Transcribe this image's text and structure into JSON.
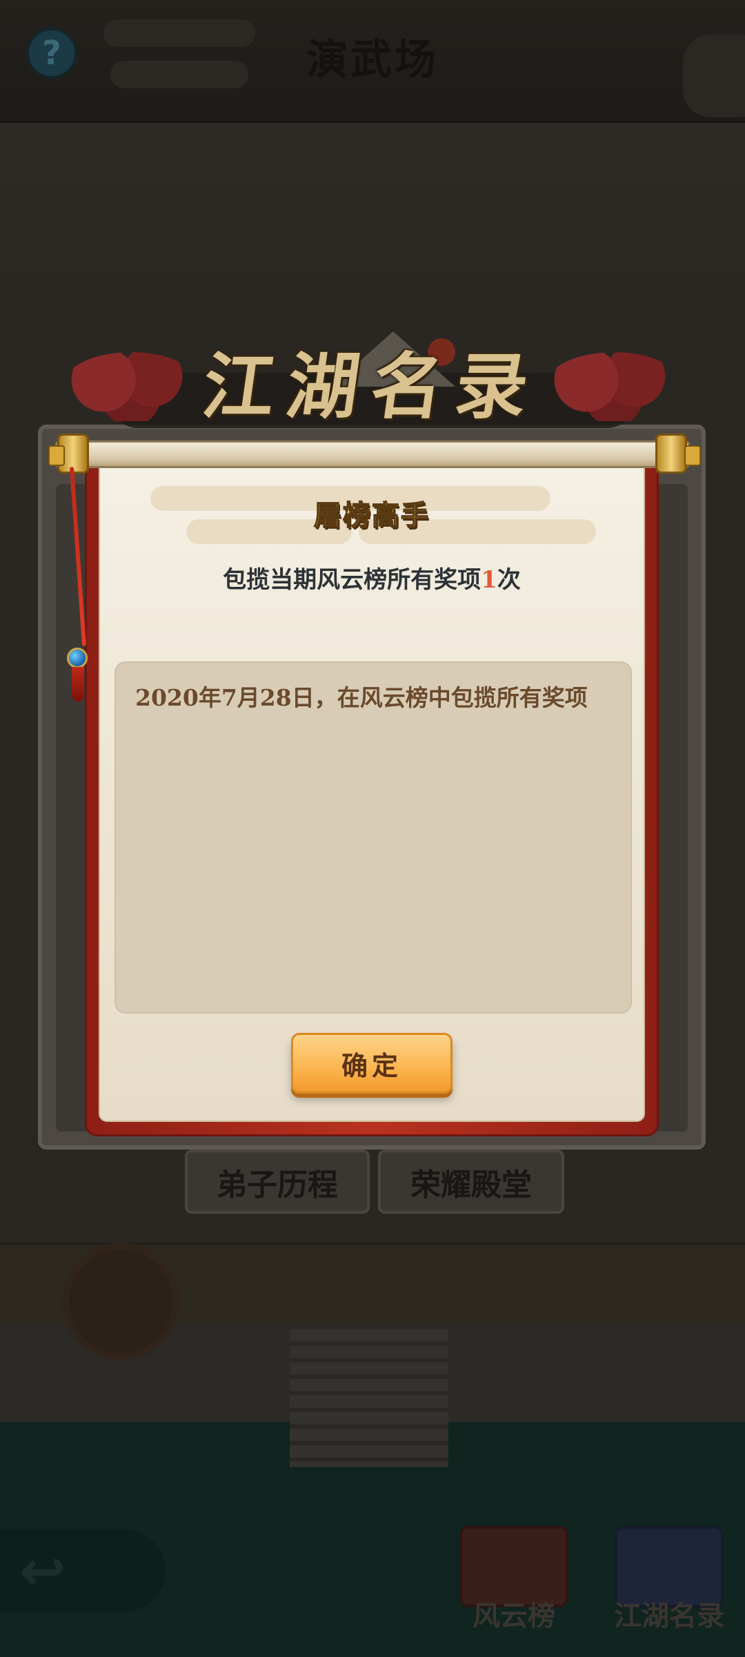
{
  "scene": {
    "title": "演武场",
    "help_icon": "?",
    "back_icon": "↩"
  },
  "background_tabs": [
    {
      "label": "弟子历程"
    },
    {
      "label": "荣耀殿堂"
    }
  ],
  "bottom_nav": [
    {
      "label": "风云榜",
      "icon": "scroll-book-icon"
    },
    {
      "label": "江湖名录",
      "icon": "open-book-icon"
    }
  ],
  "modal": {
    "banner_title": "江湖名录",
    "achievement_title": "屠榜高手",
    "description_prefix": "包揽当期风云榜所有奖项",
    "description_count": "1",
    "description_suffix": "次",
    "records": [
      "2020年7月28日，在风云榜中包揽所有奖项"
    ],
    "confirm_label": "确定"
  },
  "colors": {
    "scroll_red": "#b8321f",
    "paper": "#f5f0e4",
    "panel": "#d8ccb6",
    "button": "#fbb44f",
    "highlight_count": "#e05a3c",
    "title_gold": "#f6d778"
  }
}
